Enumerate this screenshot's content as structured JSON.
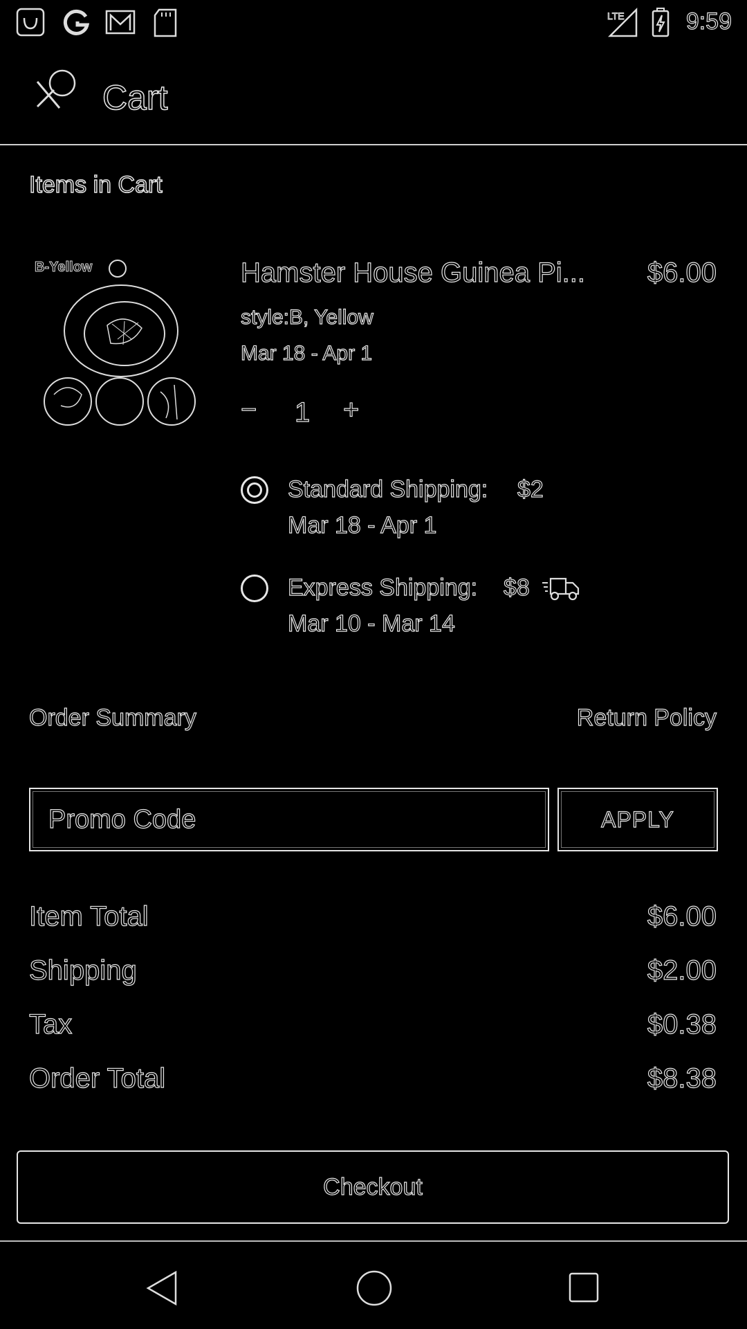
{
  "status_bar": {
    "time": "9:59",
    "left_icons": [
      "notification-icon",
      "google-icon",
      "gmail-icon",
      "sd-card-icon"
    ],
    "right_icons": [
      "lte-signal-icon",
      "battery-charging-icon"
    ],
    "network_label": "LTE"
  },
  "app_bar": {
    "title": "Cart",
    "logo_icon": "app-logo-icon"
  },
  "cart": {
    "section_title": "Items in Cart",
    "item": {
      "image_label": "B-Yellow",
      "name": "Hamster House Guinea Pi...",
      "price": "$6.00",
      "style": "style:B, Yellow",
      "delivery_date": "Mar 18 - Apr 1",
      "quantity": "1",
      "minus": "−",
      "plus": "+"
    },
    "shipping_options": [
      {
        "label": "Standard Shipping:",
        "price": "$2",
        "date": "Mar 18 - Apr 1",
        "selected": true
      },
      {
        "label": "Express Shipping:",
        "price": "$8",
        "date": "Mar 10 - Mar 14",
        "selected": false,
        "icon": "delivery-truck-icon"
      }
    ]
  },
  "order": {
    "summary_title": "Order Summary",
    "return_policy": "Return Policy",
    "promo_placeholder": "Promo Code",
    "promo_value": "",
    "apply_label": "APPLY",
    "rows": [
      {
        "label": "Item Total",
        "value": "$6.00"
      },
      {
        "label": "Shipping",
        "value": "$2.00"
      },
      {
        "label": "Tax",
        "value": "$0.38"
      },
      {
        "label": "Order Total",
        "value": "$8.38"
      }
    ],
    "checkout_label": "Checkout"
  },
  "nav_bar": {
    "icons": [
      "back-icon",
      "home-icon",
      "recents-icon"
    ]
  },
  "colors": {
    "background": "#000000",
    "foreground": "#e6e6e6"
  }
}
